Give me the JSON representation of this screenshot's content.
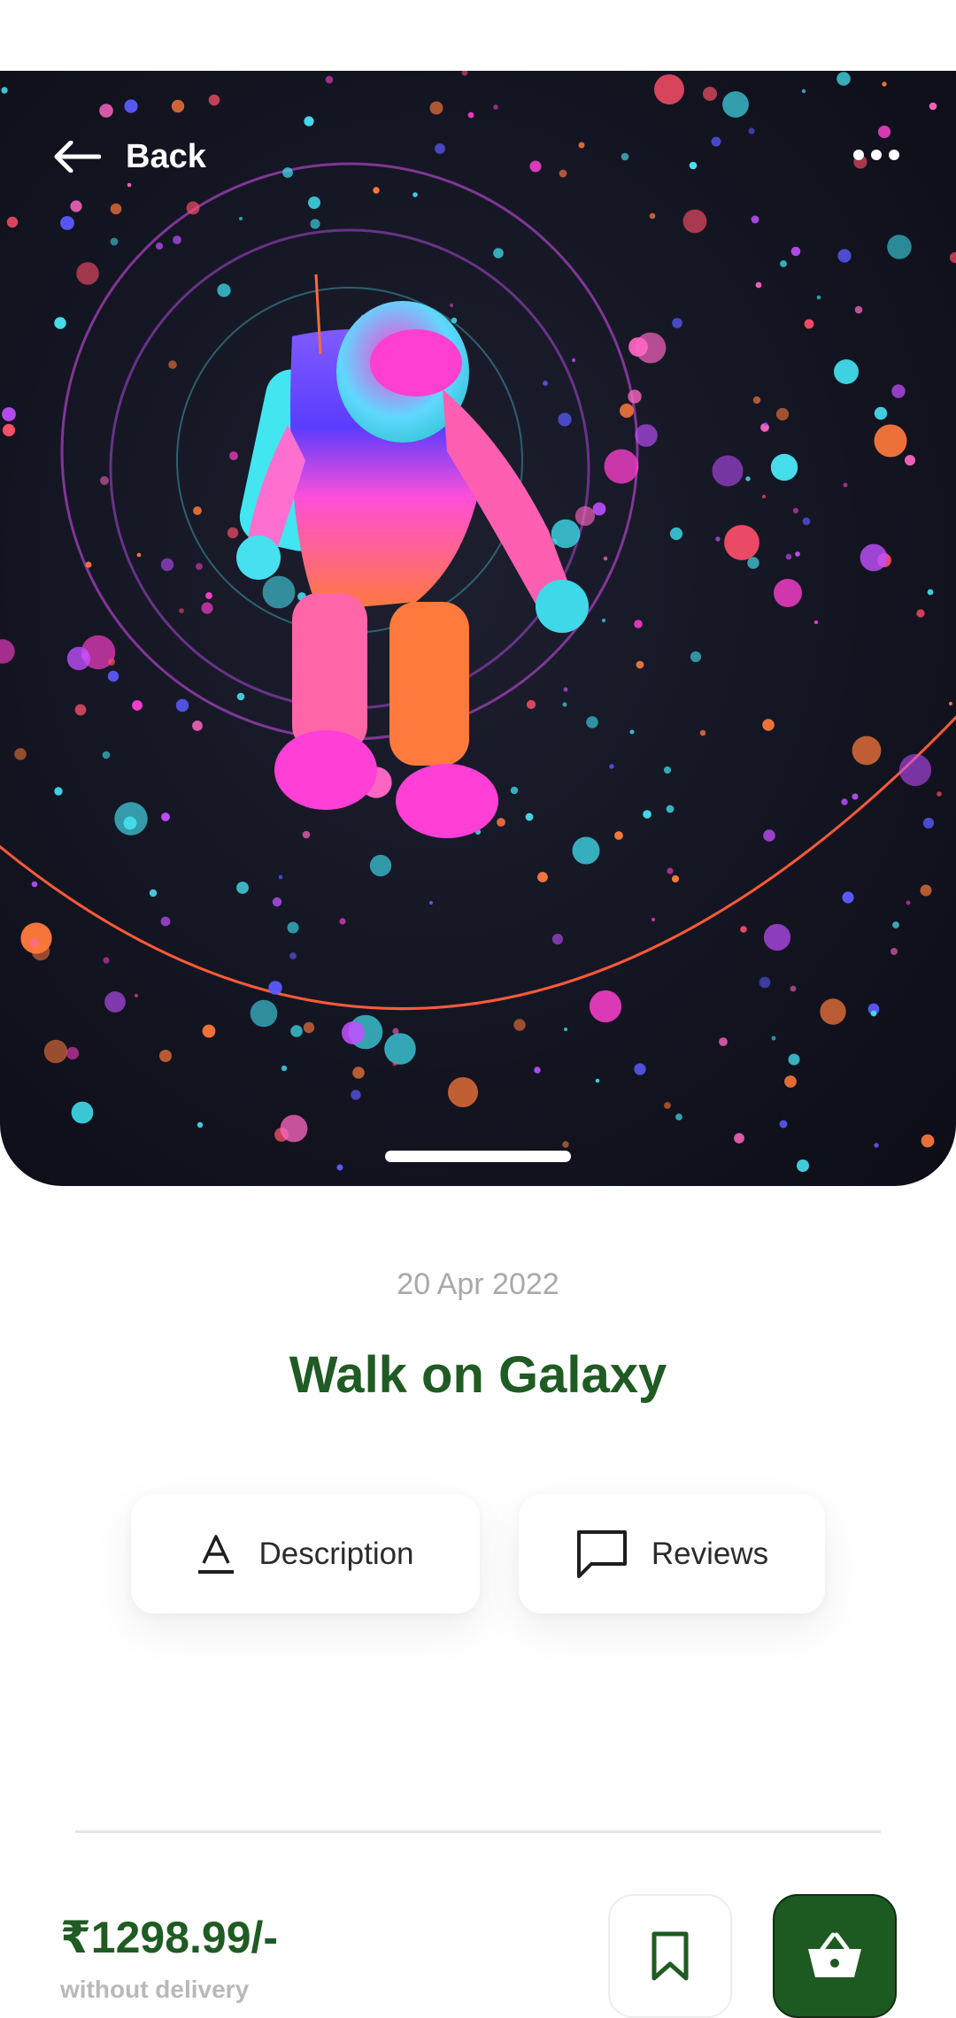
{
  "header": {
    "back_label": "Back",
    "back_icon": "arrow-left-icon",
    "more_icon": "more-dots-icon"
  },
  "hero": {
    "image_subject": "neon astronaut floating in galaxy"
  },
  "product": {
    "date": "20 Apr 2022",
    "title": "Walk on Galaxy"
  },
  "tabs": [
    {
      "label": "Description",
      "icon": "text-format-icon"
    },
    {
      "label": "Reviews",
      "icon": "comment-icon"
    }
  ],
  "footer": {
    "price": "₹1298.99/-",
    "price_note": "without delivery",
    "bookmark_icon": "bookmark-icon",
    "cart_icon": "basket-icon"
  },
  "colors": {
    "accent_green": "#1f5b22",
    "button_green": "#1d5a22",
    "muted_text": "#a9a9a9"
  }
}
